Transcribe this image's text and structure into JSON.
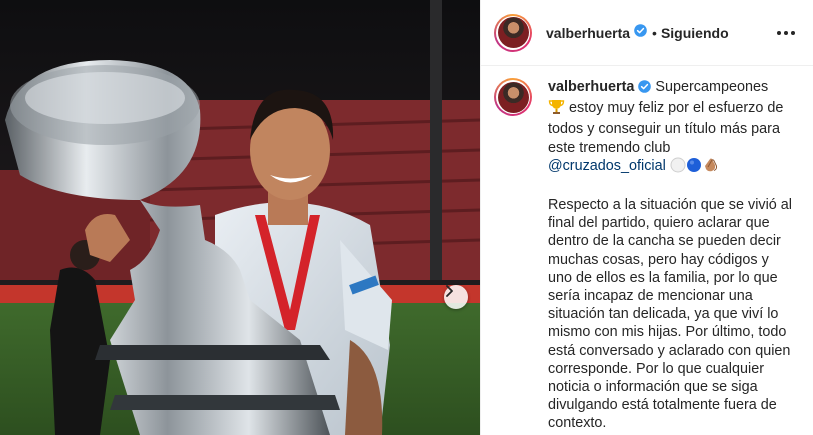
{
  "post": {
    "image_alt_icon": "carousel-next-icon",
    "header": {
      "username": "valberhuerta",
      "verified": true,
      "separator": "•",
      "follow_status": "Siguiendo"
    },
    "caption": {
      "username": "valberhuerta",
      "line1_text": "Supercampeones",
      "trophy_emoji": "🏆",
      "line2_text": " estoy muy feliz por el esfuerzo de todos y conseguir un título más para este tremendo club ",
      "mention": "@cruzados_oficial",
      "emojis": [
        "white-circle",
        "blue-circle",
        "clapping-hands"
      ],
      "paragraph2": "Respecto a la situación que se vivió al final del partido, quiero aclarar que dentro de la cancha se pueden decir muchas cosas, pero hay códigos y uno de ellos es la familia, por lo que sería incapaz de mencionar una situación tan delicada, ya que viví lo mismo con mis hijas. Por último, todo está conversado y aclarado con quien corresponde. Por lo que cualquier noticia o información que se siga divulgando está totalmente fuera de contexto."
    }
  },
  "colors": {
    "verified": "#3897f0",
    "mention": "#00376b",
    "text": "#262626",
    "border": "#efefef"
  }
}
